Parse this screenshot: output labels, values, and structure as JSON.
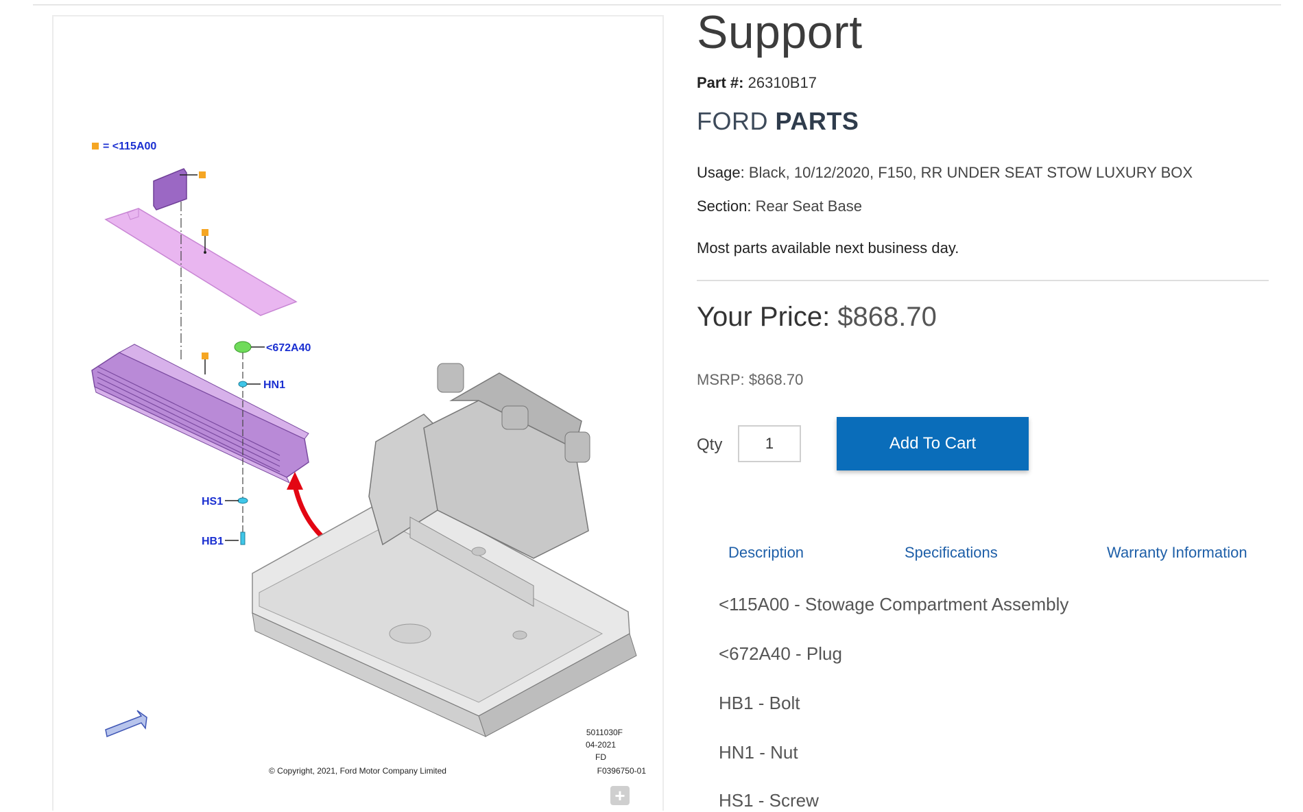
{
  "product": {
    "title": "Support",
    "part_label": "Part #:",
    "part_number": "26310B17",
    "brand_light": "FORD",
    "brand_bold": "PARTS",
    "usage_label": "Usage:",
    "usage_value": "Black, 10/12/2020, F150, RR UNDER SEAT STOW LUXURY BOX",
    "section_label": "Section:",
    "section_value": "Rear Seat Base",
    "availability": "Most parts available next business day."
  },
  "pricing": {
    "your_price_label": "Your Price:",
    "your_price": "$868.70",
    "msrp_label": "MSRP:",
    "msrp": "$868.70"
  },
  "cart": {
    "qty_label": "Qty",
    "qty_value": "1",
    "add_label": "Add To Cart"
  },
  "tabs": [
    "Description",
    "Specifications",
    "Warranty Information"
  ],
  "description_items": [
    "<115A00 - Stowage Compartment Assembly",
    "<672A40 - Plug",
    "HB1 - Bolt",
    "HN1 - Nut",
    "HS1 - Screw"
  ],
  "diagram": {
    "legend": "= <115A00",
    "callouts": [
      "<672A40",
      "HN1",
      "HS1",
      "HB1"
    ],
    "code_lines": [
      "5011030F",
      "04-2021",
      "FD",
      "F0396750-01"
    ],
    "copyright": "© Copyright, 2021, Ford Motor Company Limited"
  },
  "colors": {
    "button_blue": "#0a6dba",
    "tab_link": "#1e5fa8",
    "callout_blue": "#1a2fd1",
    "part_purple": "#a173c8",
    "orange_marker": "#f5a623",
    "arrow_red": "#e30613"
  },
  "icons": [
    "zoom-plus-icon",
    "direction-arrow-icon"
  ]
}
